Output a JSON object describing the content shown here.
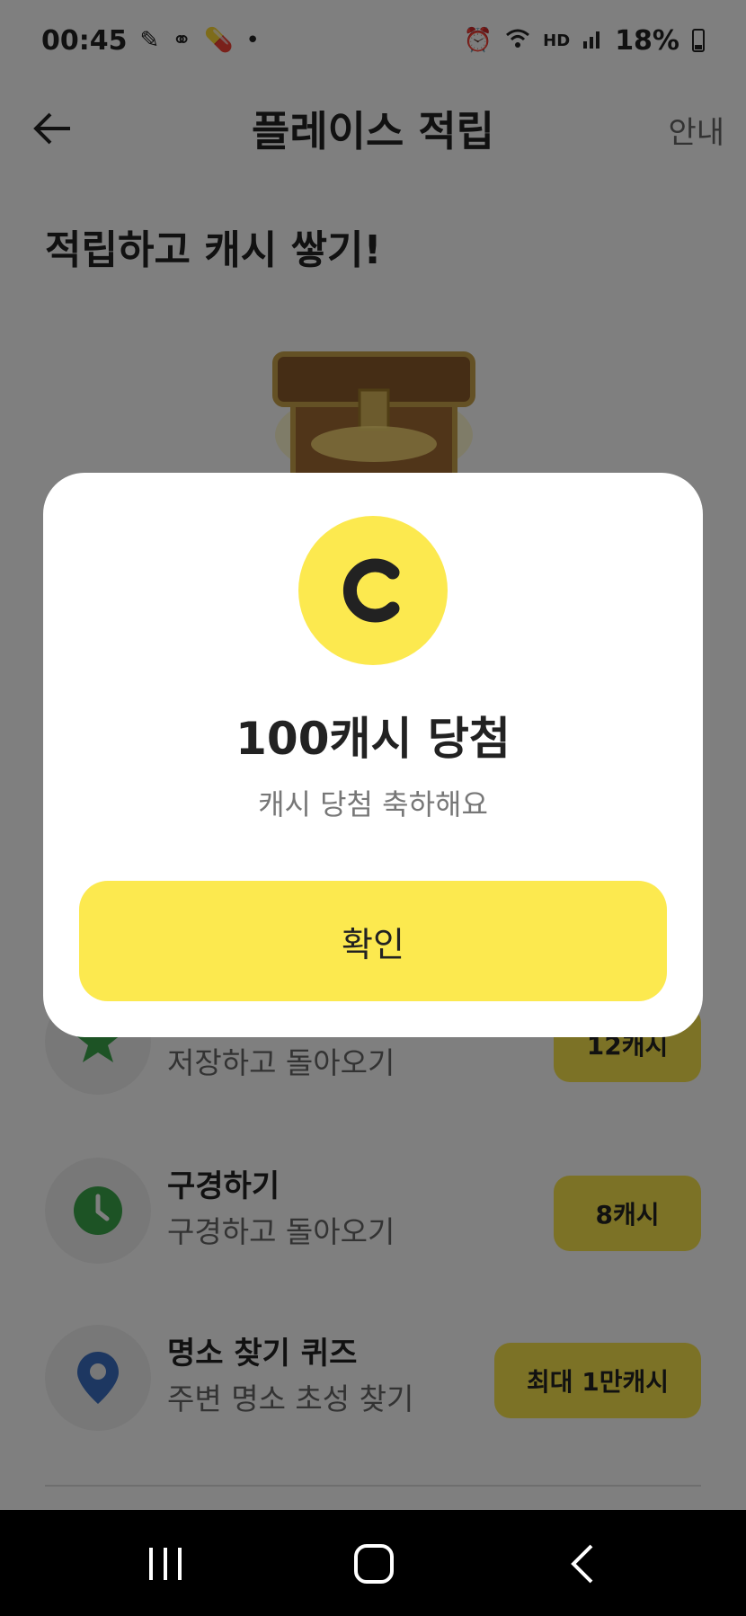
{
  "status_bar": {
    "time": "00:45",
    "left_icons": [
      "edit-icon",
      "link-icon",
      "pill-icon",
      "dot-icon"
    ],
    "right_icons": [
      "alarm-icon",
      "wifi-icon",
      "hd-voice-icon",
      "signal-icon"
    ],
    "hd_label": "HD",
    "battery": "18%"
  },
  "header": {
    "title": "플레이스 적립",
    "info_label": "안내"
  },
  "page": {
    "subtitle": "적립하고 캐시 쌓기!"
  },
  "tasks": [
    {
      "title": "",
      "subtitle": "저장하고 돌아오기",
      "badge": "12캐시",
      "icon": "star-icon",
      "color": "#3aa64a"
    },
    {
      "title": "구경하기",
      "subtitle": "구경하고 돌아오기",
      "badge": "8캐시",
      "icon": "clock-icon",
      "color": "#3aa64a"
    },
    {
      "title": "명소 찾기 퀴즈",
      "subtitle": "주변 명소 초성 찾기",
      "badge": "최대 1만캐시",
      "icon": "location-pin-icon",
      "color": "#3b6fc2"
    }
  ],
  "modal": {
    "coin_letter": "C",
    "title": "100캐시 당첨",
    "subtitle": "캐시 당첨 축하해요",
    "confirm_label": "확인"
  },
  "colors": {
    "accent_yellow": "#fce94f",
    "overlay": "rgba(0,0,0,0.5)"
  }
}
